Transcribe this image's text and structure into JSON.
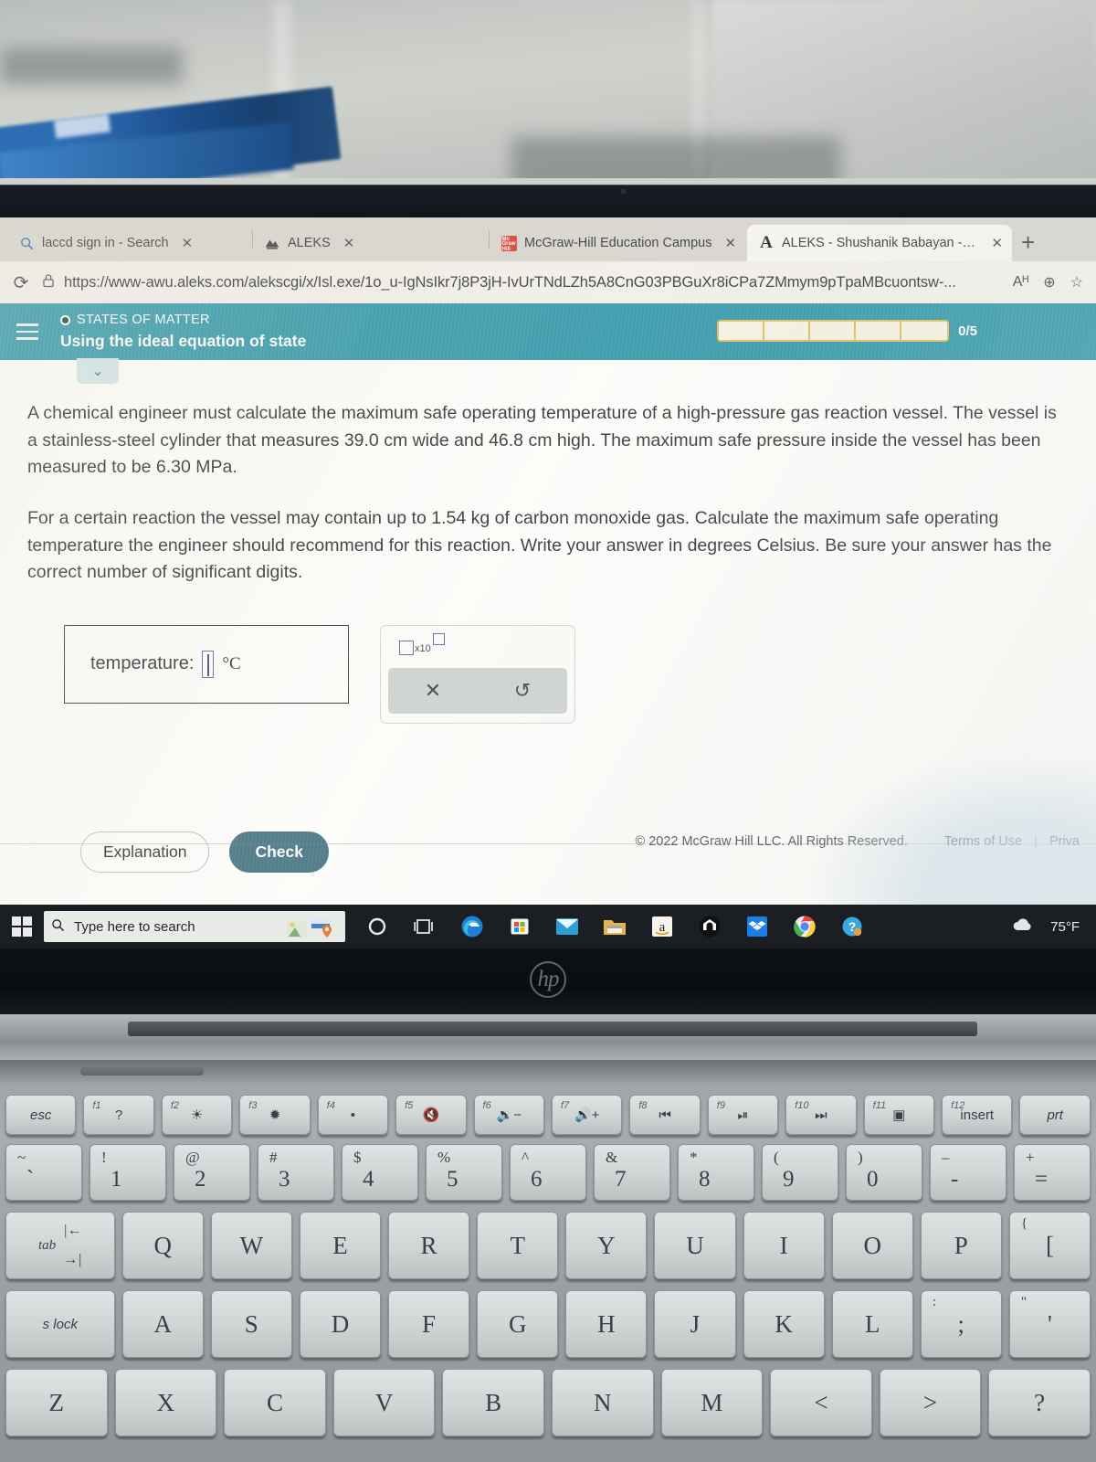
{
  "browser": {
    "tabs": [
      {
        "title": "laccd sign in - Search",
        "icon": "search-icon",
        "active": false,
        "close_label": "✕"
      },
      {
        "title": "ALEKS",
        "icon": "aleks-mountain-icon",
        "active": false,
        "close_label": "✕"
      },
      {
        "title": "McGraw-Hill Education Campus",
        "icon": "mcgraw-hill-icon",
        "active": false,
        "close_label": "✕"
      },
      {
        "title": "ALEKS - Shushanik Babayan - Le",
        "icon": "aleks-letter-icon",
        "active": true,
        "close_label": "✕"
      }
    ],
    "new_tab_label": "+",
    "reload_icon": "⟳",
    "lock_icon": "🔒",
    "url": "https://www-awu.aleks.com/alekscgi/x/Isl.exe/1o_u-IgNsIkr7j8P3jH-IvUrTNdLZh5A8CnG03PBGuXr8iCPa7ZMmym9pTpaMBcuontsw-...",
    "read_aloud_icon": "Aᴴ",
    "zoom_icon": "⊕",
    "favorite_icon": "☆"
  },
  "aleks": {
    "menu_icon": "hamburger-icon",
    "kicker": "STATES OF MATTER",
    "title": "Using the ideal equation of state",
    "progress_text": "0/5",
    "progress_segments": 5,
    "progress_filled": 0,
    "collapse_icon": "⌄",
    "accent_color": "#1f8fa4",
    "question": {
      "paragraph1": "A chemical engineer must calculate the maximum safe operating temperature of a high-pressure gas reaction vessel. The vessel is a stainless-steel cylinder that measures 39.0 cm wide and 46.8 cm high. The maximum safe pressure inside the vessel has been measured to be 6.30 MPa.",
      "paragraph2": "For a certain reaction the vessel may contain up to 1.54 kg of carbon monoxide gas. Calculate the maximum safe operating temperature the engineer should recommend for this reaction. Write your answer in degrees Celsius. Be sure your answer has the correct number of significant digits."
    },
    "answer": {
      "label": "temperature:",
      "value": "",
      "unit": "°C"
    },
    "mathpad": {
      "sci_notation_label": "x10",
      "clear_icon": "✕",
      "undo_icon": "↺"
    },
    "buttons": {
      "explanation": "Explanation",
      "check": "Check"
    },
    "footer": {
      "copyright": "© 2022 McGraw Hill LLC. All Rights Reserved.",
      "terms": "Terms of Use",
      "separator": "|",
      "privacy": "Priva"
    }
  },
  "taskbar": {
    "start_icon": "windows-icon",
    "search_placeholder": "Type here to search",
    "search_icon": "🔍",
    "items": [
      {
        "name": "cortana-icon",
        "glyph": "○"
      },
      {
        "name": "task-view-icon",
        "glyph": "⧉"
      },
      {
        "name": "edge-icon",
        "glyph": "e"
      },
      {
        "name": "microsoft-store-icon",
        "glyph": "⊞"
      },
      {
        "name": "mail-icon",
        "glyph": "✉"
      },
      {
        "name": "file-explorer-icon",
        "glyph": "🗀"
      },
      {
        "name": "amazon-icon",
        "glyph": "a"
      },
      {
        "name": "nest-icon",
        "glyph": "⌂"
      },
      {
        "name": "dropbox-icon",
        "glyph": "❖"
      },
      {
        "name": "chrome-icon",
        "glyph": "◉"
      },
      {
        "name": "help-icon",
        "glyph": "?"
      }
    ],
    "weather_icon": "☁",
    "weather_temp": "75°F"
  },
  "laptop": {
    "brand_logo": "hp",
    "keyboard": {
      "function_row": [
        {
          "main": "esc",
          "fn": "",
          "type": "text"
        },
        {
          "main": "?",
          "fn": "f1",
          "type": "fn"
        },
        {
          "main": "☀",
          "fn": "f2",
          "type": "fn"
        },
        {
          "main": "✹",
          "fn": "f3",
          "type": "fn"
        },
        {
          "main": "•",
          "fn": "f4",
          "type": "fn"
        },
        {
          "main": "🔇",
          "fn": "f5",
          "type": "fn"
        },
        {
          "main": "🔉−",
          "fn": "f6",
          "type": "fn"
        },
        {
          "main": "🔊+",
          "fn": "f7",
          "type": "fn"
        },
        {
          "main": "⏮",
          "fn": "f8",
          "type": "fn"
        },
        {
          "main": "⏯",
          "fn": "f9",
          "type": "fn"
        },
        {
          "main": "⏭",
          "fn": "f10",
          "type": "fn"
        },
        {
          "main": "▣",
          "fn": "f11",
          "type": "fn"
        },
        {
          "main": "insert",
          "fn": "f12",
          "type": "fn-text"
        },
        {
          "main": "prt",
          "fn": "",
          "type": "text"
        }
      ],
      "number_row": [
        {
          "main": "`",
          "shift": "~"
        },
        {
          "main": "1",
          "shift": "!"
        },
        {
          "main": "2",
          "shift": "@"
        },
        {
          "main": "3",
          "shift": "#"
        },
        {
          "main": "4",
          "shift": "$"
        },
        {
          "main": "5",
          "shift": "%"
        },
        {
          "main": "6",
          "shift": "^"
        },
        {
          "main": "7",
          "shift": "&"
        },
        {
          "main": "8",
          "shift": "*"
        },
        {
          "main": "9",
          "shift": "("
        },
        {
          "main": "0",
          "shift": ")"
        },
        {
          "main": "-",
          "shift": "–"
        },
        {
          "main": "=",
          "shift": "+"
        }
      ],
      "top_alpha_row": [
        {
          "main": "tab",
          "type": "tab"
        },
        {
          "main": "Q"
        },
        {
          "main": "W"
        },
        {
          "main": "E"
        },
        {
          "main": "R"
        },
        {
          "main": "T"
        },
        {
          "main": "Y"
        },
        {
          "main": "U"
        },
        {
          "main": "I"
        },
        {
          "main": "O"
        },
        {
          "main": "P"
        },
        {
          "main": "[",
          "shift": "{"
        }
      ],
      "home_alpha_row": [
        {
          "main": "s lock",
          "type": "caps"
        },
        {
          "main": "A"
        },
        {
          "main": "S"
        },
        {
          "main": "D"
        },
        {
          "main": "F"
        },
        {
          "main": "G"
        },
        {
          "main": "H"
        },
        {
          "main": "J"
        },
        {
          "main": "K"
        },
        {
          "main": "L"
        },
        {
          "main": ";",
          "shift": ":"
        },
        {
          "main": "'",
          "shift": "\""
        }
      ],
      "bottom_alpha_row": [
        {
          "main": "Z"
        },
        {
          "main": "X"
        },
        {
          "main": "C"
        },
        {
          "main": "V"
        },
        {
          "main": "B"
        },
        {
          "main": "N"
        },
        {
          "main": "M"
        },
        {
          "main": "<"
        },
        {
          "main": ">"
        },
        {
          "main": "?"
        }
      ]
    }
  }
}
